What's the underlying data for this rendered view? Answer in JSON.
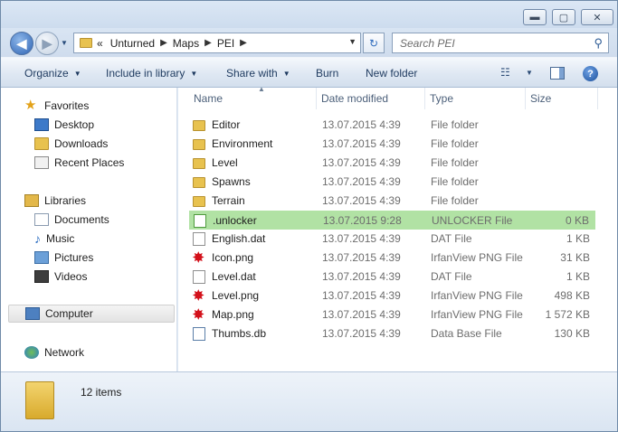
{
  "window": {
    "controls": {
      "minimize": "▬",
      "maximize": "▢",
      "close": "✕"
    }
  },
  "nav": {
    "back": "◀",
    "forward": "▶",
    "history_drop": "▼"
  },
  "address": {
    "prefix": "«",
    "crumbs": [
      "Unturned",
      "Maps",
      "PEI"
    ],
    "separator": "▶",
    "drop": "▼"
  },
  "refresh_glyph": "↻",
  "search": {
    "placeholder": "Search PEI",
    "icon": "⚲"
  },
  "toolbar": {
    "organize": "Organize",
    "include": "Include in library",
    "share": "Share with",
    "burn": "Burn",
    "new_folder": "New folder",
    "views_icon": "☷",
    "views_drop": "▼",
    "help": "?",
    "caret": "▼"
  },
  "sidebar": {
    "favorites": "Favorites",
    "desktop": "Desktop",
    "downloads": "Downloads",
    "recent": "Recent Places",
    "libraries": "Libraries",
    "documents": "Documents",
    "music": "Music",
    "pictures": "Pictures",
    "videos": "Videos",
    "computer": "Computer",
    "network": "Network",
    "star_glyph": "★",
    "note_glyph": "♪"
  },
  "columns": {
    "name": "Name",
    "date": "Date modified",
    "type": "Type",
    "size": "Size",
    "sort_arrow": "▲"
  },
  "files": [
    {
      "name": "Editor",
      "date": "13.07.2015 4:39",
      "type": "File folder",
      "size": "",
      "icon": "folder-icon"
    },
    {
      "name": "Environment",
      "date": "13.07.2015 4:39",
      "type": "File folder",
      "size": "",
      "icon": "folder-icon"
    },
    {
      "name": "Level",
      "date": "13.07.2015 4:39",
      "type": "File folder",
      "size": "",
      "icon": "folder-icon"
    },
    {
      "name": "Spawns",
      "date": "13.07.2015 4:39",
      "type": "File folder",
      "size": "",
      "icon": "folder-icon"
    },
    {
      "name": "Terrain",
      "date": "13.07.2015 4:39",
      "type": "File folder",
      "size": "",
      "icon": "folder-icon"
    },
    {
      "name": ".unlocker",
      "date": "13.07.2015 9:28",
      "type": "UNLOCKER File",
      "size": "0 KB",
      "icon": "file-icon",
      "selected": true
    },
    {
      "name": "English.dat",
      "date": "13.07.2015 4:39",
      "type": "DAT File",
      "size": "1 KB",
      "icon": "file-icon"
    },
    {
      "name": "Icon.png",
      "date": "13.07.2015 4:39",
      "type": "IrfanView PNG File",
      "size": "31 KB",
      "icon": "irfanview-icon"
    },
    {
      "name": "Level.dat",
      "date": "13.07.2015 4:39",
      "type": "DAT File",
      "size": "1 KB",
      "icon": "file-icon"
    },
    {
      "name": "Level.png",
      "date": "13.07.2015 4:39",
      "type": "IrfanView PNG File",
      "size": "498 KB",
      "icon": "irfanview-icon"
    },
    {
      "name": "Map.png",
      "date": "13.07.2015 4:39",
      "type": "IrfanView PNG File",
      "size": "1 572 KB",
      "icon": "irfanview-icon"
    },
    {
      "name": "Thumbs.db",
      "date": "13.07.2015 4:39",
      "type": "Data Base File",
      "size": "130 KB",
      "icon": "database-icon"
    }
  ],
  "status": {
    "count": "12 items"
  },
  "colors": {
    "selection": "#b1e2a4",
    "link_text": "#1e3a5f",
    "muted_text": "#6d6d6d"
  }
}
